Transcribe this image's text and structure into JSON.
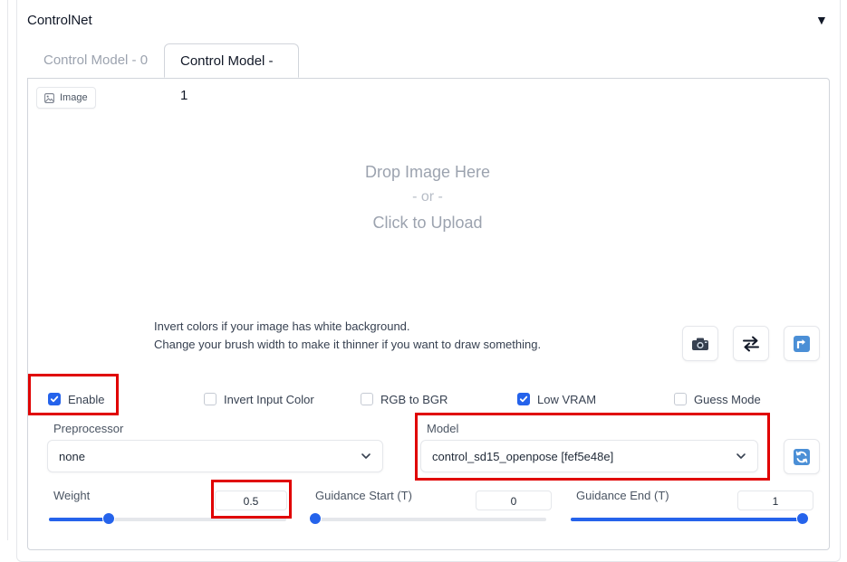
{
  "panel": {
    "title": "ControlNet",
    "collapse_icon": "▼"
  },
  "tabs": [
    {
      "label": "Control Model - 0",
      "active": false
    },
    {
      "label": "Control Model - 1",
      "active": true
    }
  ],
  "image": {
    "chip_label": "Image",
    "drop_text": "Drop Image Here",
    "or_text": "- or -",
    "upload_text": "Click to Upload"
  },
  "hints": [
    "Invert colors if your image has white background.",
    "Change your brush width to make it thinner if you want to draw something."
  ],
  "tools": {
    "camera_icon": "camera-icon",
    "swap_icon": "swap-arrows-icon",
    "upload_icon": "upload-arrow-icon",
    "refresh_icon": "refresh-icon"
  },
  "checkboxes": [
    {
      "label": "Enable",
      "checked": true
    },
    {
      "label": "Invert Input Color",
      "checked": false
    },
    {
      "label": "RGB to BGR",
      "checked": false
    },
    {
      "label": "Low VRAM",
      "checked": true
    },
    {
      "label": "Guess Mode",
      "checked": false
    }
  ],
  "preprocessor": {
    "label": "Preprocessor",
    "value": "none"
  },
  "model": {
    "label": "Model",
    "value": "control_sd15_openpose [fef5e48e]"
  },
  "sliders": {
    "weight": {
      "label": "Weight",
      "value": "0.5",
      "min": 0,
      "max": 2,
      "fraction": 0.25
    },
    "guidance_start": {
      "label": "Guidance Start (T)",
      "value": "0",
      "min": 0,
      "max": 1,
      "fraction": 0.0
    },
    "guidance_end": {
      "label": "Guidance End (T)",
      "value": "1",
      "min": 0,
      "max": 1,
      "fraction": 1.0
    }
  },
  "colors": {
    "accent": "#2563eb",
    "highlight": "#e00000"
  }
}
